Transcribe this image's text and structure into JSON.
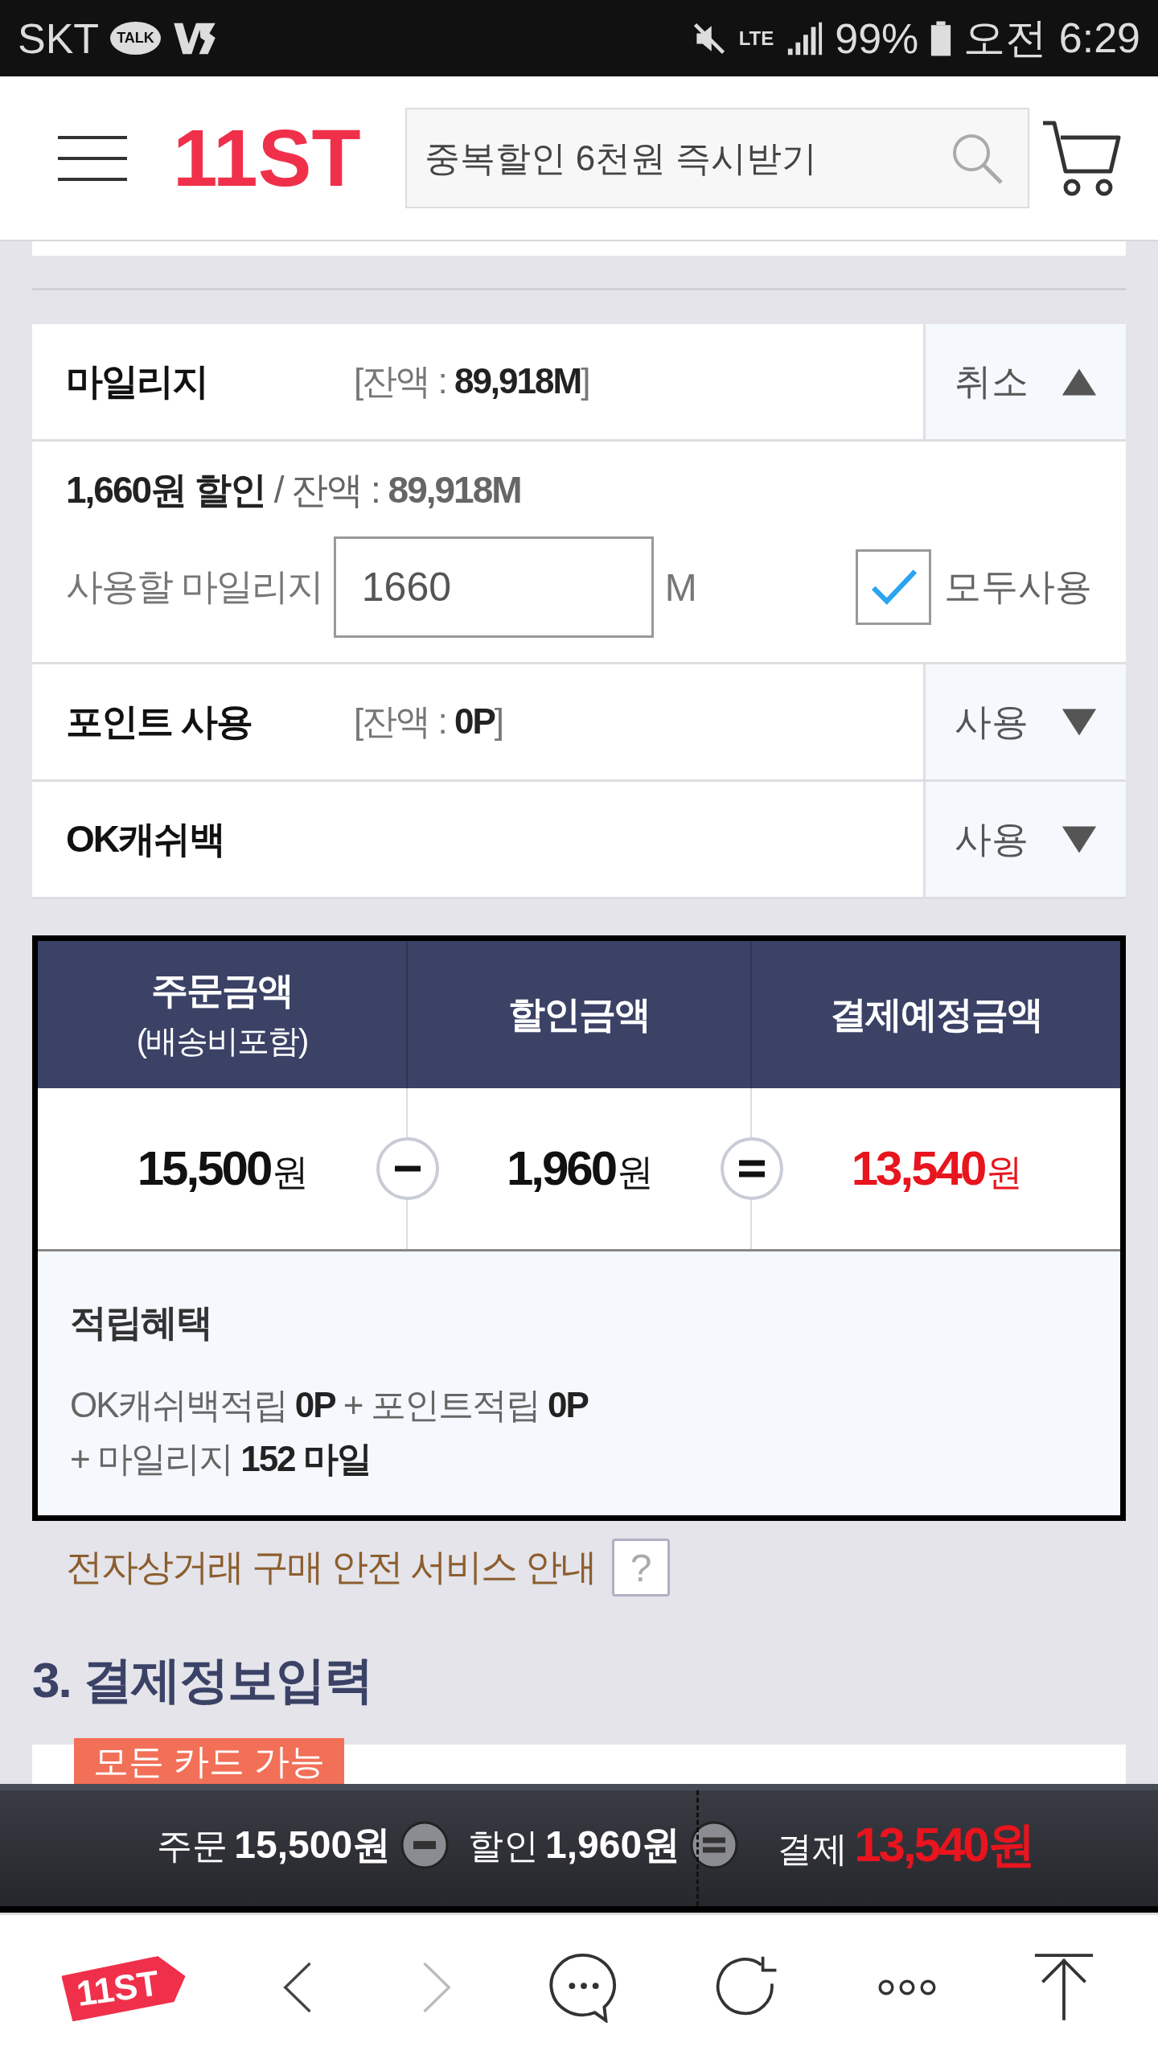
{
  "status_bar": {
    "carrier": "SKT",
    "talk_badge": "TALK",
    "network": "LTE",
    "battery": "99%",
    "time": "오전 6:29"
  },
  "header": {
    "logo": "11ST",
    "search": {
      "placeholder": "중복할인 6천원 즉시받기"
    }
  },
  "discounts": [
    {
      "title": "마일리지",
      "balance": "[잔액 : **89,918M**]",
      "action": "취소",
      "expanded": true,
      "detail": {
        "summary": "**1,660원 할인** / 잔액 : **89,918M**",
        "label": "사용할 마일리지",
        "value": "1660",
        "unit": "M",
        "use_all": {
          "label": "모두사용",
          "checked": true
        }
      }
    },
    {
      "title": "포인트 사용",
      "balance": "[잔액 : **0P**]",
      "action": "사용",
      "expanded": false
    },
    {
      "title": "OK캐쉬백",
      "action": "사용",
      "expanded": false
    }
  ],
  "summary": {
    "columns": [
      {
        "label": "주문금액",
        "sub": "(배송비포함)",
        "amount": "15,500",
        "unit": "원",
        "emphasis": false
      },
      {
        "label": "할인금액",
        "amount": "1,960",
        "unit": "원",
        "emphasis": false
      },
      {
        "label": "결제예정금액",
        "amount": "13,540",
        "unit": "원",
        "emphasis": true
      }
    ],
    "operators": [
      {
        "kind": "minus"
      },
      {
        "kind": "equals"
      }
    ],
    "benefits": {
      "title": "적립혜택",
      "lines": [
        "OK캐쉬백적립 **0P** + 포인트적립 **0P**",
        "+ 마일리지 **152 마일**"
      ]
    }
  },
  "safety_link": {
    "label": "전자상거래 구매 안전 서비스 안내",
    "help": "?"
  },
  "payment_section": {
    "title": "3. 결제정보입력",
    "badge": "모든 카드 가능"
  },
  "bottom_summary": {
    "items": [
      {
        "label": "주문",
        "amount": "15,500원",
        "emphasis": false
      },
      {
        "label": "할인",
        "amount": "1,960원",
        "emphasis": false
      },
      {
        "label": "결제",
        "amount": "13,540원",
        "emphasis": true
      }
    ],
    "operators": [
      {
        "kind": "minus"
      },
      {
        "kind": "equals"
      }
    ]
  },
  "bottom_nav": {
    "logo": "11ST"
  }
}
